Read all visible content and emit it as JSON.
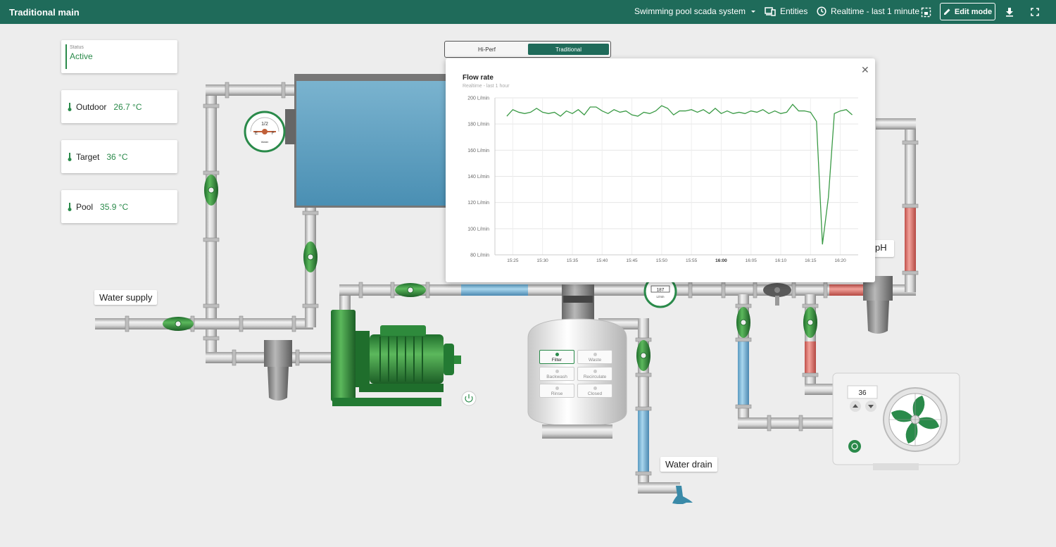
{
  "topbar": {
    "title": "Traditional main",
    "dashboard_select": "Swimming pool scada system",
    "entities_label": "Entities",
    "time_label": "Realtime - last 1 minute",
    "edit_label": "Edit mode"
  },
  "cards": {
    "status": {
      "label": "Status",
      "value": "Active"
    },
    "outdoor": {
      "label": "Outdoor",
      "value": "26.7 °C"
    },
    "target": {
      "label": "Target",
      "value": "36 °C"
    },
    "pool": {
      "label": "Pool",
      "value": "35.9 °C"
    }
  },
  "toggle": {
    "options": [
      "Hi-Perf",
      "Traditional"
    ],
    "selected": "Traditional"
  },
  "labels": {
    "water_supply": "Water supply",
    "water_drain": "Water drain",
    "ph": "pH"
  },
  "gauge": {
    "value": "1/2",
    "e": "E",
    "f": "F",
    "name": "Water"
  },
  "flow_meter": {
    "value": "187",
    "unit": "L/min"
  },
  "valve_panel": {
    "buttons": [
      "Filter",
      "Waste",
      "Backwash",
      "Recirculate",
      "Rinse",
      "Closed"
    ],
    "selected": "Filter"
  },
  "heat_pump": {
    "set_value": "36"
  },
  "popup": {
    "title": "Flow rate",
    "subtitle": "Realtime - last 1 hour"
  },
  "chart_data": {
    "type": "line",
    "title": "Flow rate",
    "subtitle": "Realtime - last 1 hour",
    "ylim": [
      80,
      200
    ],
    "yticks": [
      "80 L/min",
      "100 L/min",
      "120 L/min",
      "140 L/min",
      "160 L/min",
      "180 L/min",
      "200 L/min"
    ],
    "xticks": [
      "15:25",
      "15:30",
      "15:35",
      "15:40",
      "15:45",
      "15:50",
      "15:55",
      "16:00",
      "16:05",
      "16:10",
      "16:15",
      "16:20"
    ],
    "x_minutes": [
      24,
      25,
      26,
      27,
      28,
      29,
      30,
      31,
      32,
      33,
      34,
      35,
      36,
      37,
      38,
      39,
      40,
      41,
      42,
      43,
      44,
      45,
      46,
      47,
      48,
      49,
      50,
      51,
      52,
      53,
      54,
      55,
      56,
      57,
      58,
      59,
      60,
      61,
      62,
      63,
      64,
      65,
      66,
      67,
      68,
      69,
      70,
      71,
      72,
      73,
      74,
      75,
      76,
      77,
      78,
      79,
      80,
      81,
      82
    ],
    "series": [
      {
        "values": [
          186,
          191,
          189,
          188,
          189,
          192,
          189,
          188,
          189,
          186,
          190,
          188,
          191,
          187,
          193,
          193,
          190,
          188,
          191,
          189,
          190,
          187,
          186,
          189,
          188,
          190,
          194,
          192,
          187,
          190,
          190,
          191,
          189,
          191,
          188,
          192,
          188,
          190,
          188,
          189,
          188,
          190,
          189,
          191,
          188,
          190,
          188,
          189,
          195,
          190,
          190,
          189,
          182,
          88,
          124,
          188,
          190,
          191,
          187
        ],
        "color": "#3a9a45"
      }
    ],
    "grid": true
  }
}
